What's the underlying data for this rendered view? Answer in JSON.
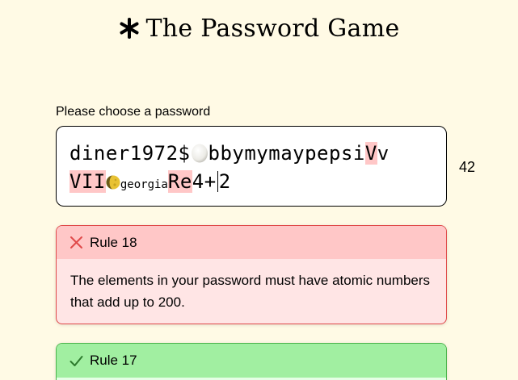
{
  "header": {
    "title": "The Password Game",
    "icon": "asterisk-icon"
  },
  "password": {
    "prompt": "Please choose a password",
    "line1": {
      "a": "diner1972$",
      "egg": "egg-icon",
      "b": "bbymymaypepsi",
      "c": "V",
      "d": "v"
    },
    "line2": {
      "a": "VII",
      "moon": "moon-icon",
      "small": "georgia",
      "b": "Re",
      "c": "4+",
      "d": "2"
    },
    "char_count": "42"
  },
  "rules": [
    {
      "label": "Rule 18",
      "status": "fail",
      "icon": "x-icon",
      "text": "The elements in your password must have atomic numbers that add up to 200."
    },
    {
      "label": "Rule 17",
      "status": "pass",
      "icon": "check-icon"
    }
  ],
  "colors": {
    "background": "#fffae5",
    "highlight": "#ffc7c7",
    "fail_border": "#e04a4a",
    "pass_header": "#a1efa1"
  }
}
